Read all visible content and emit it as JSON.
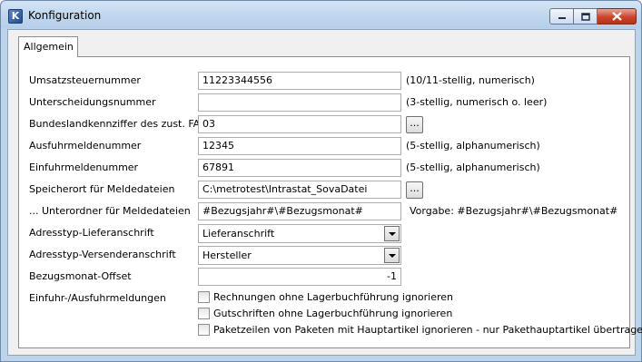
{
  "window": {
    "title": "Konfiguration",
    "icon": "app-icon",
    "controls": {
      "minimize": "minimize-icon",
      "maximize": "maximize-icon",
      "close": "close-icon"
    }
  },
  "tabs": [
    {
      "label": "Allgemein",
      "active": true
    }
  ],
  "fields": {
    "umsatzsteuer": {
      "label": "Umsatzsteuernummer",
      "value": "11223344556",
      "hint": "(10/11-stellig, numerisch)"
    },
    "unterscheidung": {
      "label": "Unterscheidungsnummer",
      "value": "",
      "hint": "(3-stellig, numerisch o. leer)"
    },
    "bundesland": {
      "label": "Bundeslandkennziffer des zust. FA",
      "value": "03",
      "button": "..."
    },
    "ausfuhr": {
      "label": "Ausfuhrmeldenummer",
      "value": "12345",
      "hint": "(5-stellig, alphanumerisch)"
    },
    "einfuhr": {
      "label": "Einfuhrmeldenummer",
      "value": "67891",
      "hint": "(5-stellig, alphanumerisch)"
    },
    "speicherort": {
      "label": "Speicherort für Meldedateien",
      "value": "C:\\metrotest\\Intrastat_SovaDatei",
      "button": "..."
    },
    "unterordner": {
      "label": "... Unterordner für Meldedateien",
      "value": "#Bezugsjahr#\\#Bezugsmonat#",
      "hint": "Vorgabe: #Bezugsjahr#\\#Bezugsmonat#"
    },
    "lieferanschrift": {
      "label": "Adresstyp-Lieferanschrift",
      "value": "Lieferanschrift"
    },
    "versenderanschrift": {
      "label": "Adresstyp-Versenderanschrift",
      "value": "Hersteller"
    },
    "offset": {
      "label": "Bezugsmonat-Offset",
      "value": "-1"
    },
    "meldungen": {
      "label": "Einfuhr-/Ausfuhrmeldungen",
      "checkboxes": [
        {
          "label": "Rechnungen ohne Lagerbuchführung ignorieren",
          "checked": false
        },
        {
          "label": "Gutschriften ohne Lagerbuchführung ignorieren",
          "checked": false
        },
        {
          "label": "Paketzeilen von Paketen mit Hauptartikel ignorieren - nur Pakethauptartikel übertragen",
          "checked": false
        }
      ]
    }
  },
  "colors": {
    "titlebar": "#bcd3ea",
    "close": "#c9452b",
    "panel": "#ffffff",
    "client": "#f0f0f0"
  }
}
